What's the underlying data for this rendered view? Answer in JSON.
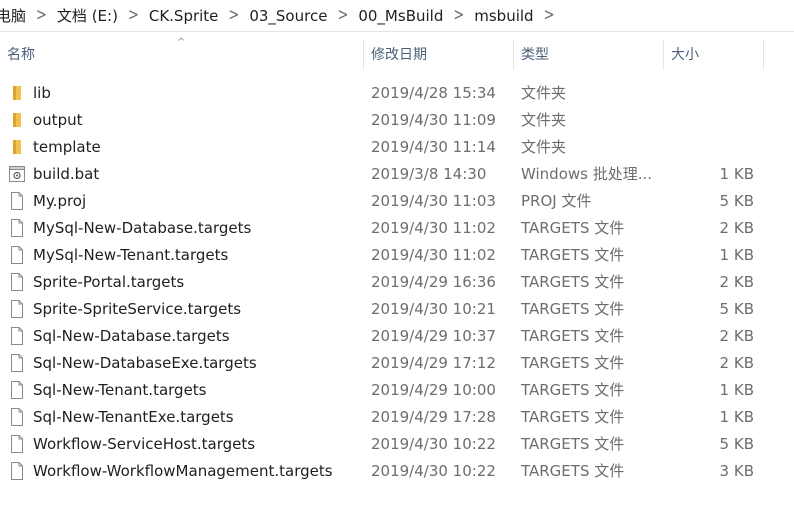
{
  "breadcrumb": [
    "电脑",
    "文档 (E:)",
    "CK.Sprite",
    "03_Source",
    "00_MsBuild",
    "msbuild"
  ],
  "breadcrumb_separator": ">",
  "columns": {
    "name": "名称",
    "date": "修改日期",
    "type": "类型",
    "size": "大小"
  },
  "sort_indicator": "^",
  "files": [
    {
      "name": "lib",
      "date": "2019/4/28 15:34",
      "type": "文件夹",
      "size": "",
      "icon": "folder-icon"
    },
    {
      "name": "output",
      "date": "2019/4/30 11:09",
      "type": "文件夹",
      "size": "",
      "icon": "folder-icon"
    },
    {
      "name": "template",
      "date": "2019/4/30 11:14",
      "type": "文件夹",
      "size": "",
      "icon": "folder-icon"
    },
    {
      "name": "build.bat",
      "date": "2019/3/8 14:30",
      "type": "Windows 批处理...",
      "size": "1 KB",
      "icon": "batch-file-icon"
    },
    {
      "name": "My.proj",
      "date": "2019/4/30 11:03",
      "type": "PROJ 文件",
      "size": "5 KB",
      "icon": "file-icon"
    },
    {
      "name": "MySql-New-Database.targets",
      "date": "2019/4/30 11:02",
      "type": "TARGETS 文件",
      "size": "2 KB",
      "icon": "file-icon"
    },
    {
      "name": "MySql-New-Tenant.targets",
      "date": "2019/4/30 11:02",
      "type": "TARGETS 文件",
      "size": "1 KB",
      "icon": "file-icon"
    },
    {
      "name": "Sprite-Portal.targets",
      "date": "2019/4/29 16:36",
      "type": "TARGETS 文件",
      "size": "2 KB",
      "icon": "file-icon"
    },
    {
      "name": "Sprite-SpriteService.targets",
      "date": "2019/4/30 10:21",
      "type": "TARGETS 文件",
      "size": "5 KB",
      "icon": "file-icon"
    },
    {
      "name": "Sql-New-Database.targets",
      "date": "2019/4/29 10:37",
      "type": "TARGETS 文件",
      "size": "2 KB",
      "icon": "file-icon"
    },
    {
      "name": "Sql-New-DatabaseExe.targets",
      "date": "2019/4/29 17:12",
      "type": "TARGETS 文件",
      "size": "2 KB",
      "icon": "file-icon"
    },
    {
      "name": "Sql-New-Tenant.targets",
      "date": "2019/4/29 10:00",
      "type": "TARGETS 文件",
      "size": "1 KB",
      "icon": "file-icon"
    },
    {
      "name": "Sql-New-TenantExe.targets",
      "date": "2019/4/29 17:28",
      "type": "TARGETS 文件",
      "size": "1 KB",
      "icon": "file-icon"
    },
    {
      "name": "Workflow-ServiceHost.targets",
      "date": "2019/4/30 10:22",
      "type": "TARGETS 文件",
      "size": "5 KB",
      "icon": "file-icon"
    },
    {
      "name": "Workflow-WorkflowManagement.targets",
      "date": "2019/4/30 10:22",
      "type": "TARGETS 文件",
      "size": "3 KB",
      "icon": "file-icon"
    }
  ],
  "colors": {
    "folder": "#f2c14e",
    "folder_dark": "#d9a52f",
    "file_outline": "#8a8a8a",
    "header_text": "#4c607a",
    "secondary_text": "#6d6d6d"
  }
}
